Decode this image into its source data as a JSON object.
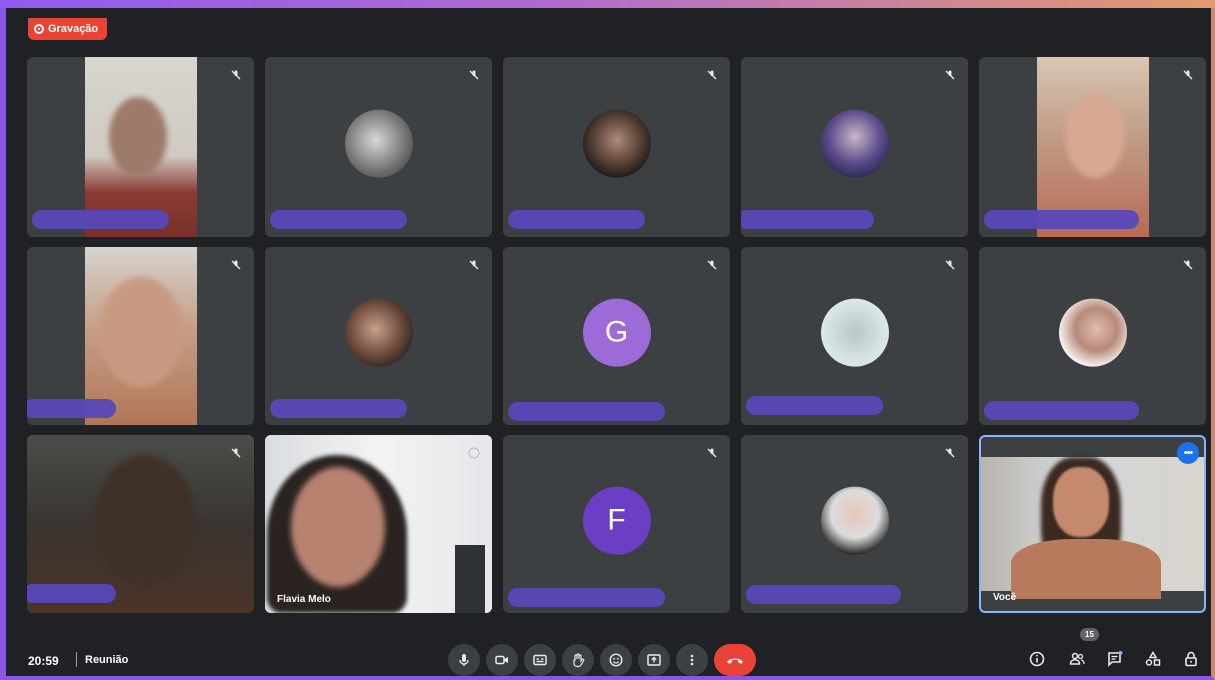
{
  "recording": {
    "label": "Gravação"
  },
  "tiles": [
    {
      "id": "t1",
      "letter": "",
      "name": ""
    },
    {
      "id": "t2",
      "letter": "",
      "name": ""
    },
    {
      "id": "t3",
      "letter": "",
      "name": ""
    },
    {
      "id": "t4",
      "letter": "",
      "name": ""
    },
    {
      "id": "t5",
      "letter": "",
      "name": ""
    },
    {
      "id": "t6",
      "letter": "",
      "name": ""
    },
    {
      "id": "t7",
      "letter": "",
      "name": ""
    },
    {
      "id": "t8",
      "letter": "G",
      "name": ""
    },
    {
      "id": "t9",
      "letter": "",
      "name": ""
    },
    {
      "id": "t10",
      "letter": "",
      "name": ""
    },
    {
      "id": "t11",
      "letter": "",
      "name": ""
    },
    {
      "id": "t12",
      "letter": "",
      "name": "Flavia Melo"
    },
    {
      "id": "t13",
      "letter": "F",
      "name": ""
    },
    {
      "id": "t14",
      "letter": "",
      "name": ""
    },
    {
      "id": "t15",
      "letter": "",
      "name": "Você",
      "more_icon": "more-horiz-icon",
      "more_label": "•••"
    }
  ],
  "colors": {
    "accent": "#1a73e8",
    "tile_bg": "#3c4043",
    "name_bar": "#5848b8",
    "avatar_g": "#9c6bd8",
    "avatar_f": "#6a3fc4",
    "hangup": "#ea4335"
  },
  "bottom_bar": {
    "time": "20:59",
    "meeting_title": "Reunião",
    "controls": [
      "microphone-icon",
      "camera-icon",
      "captions-icon",
      "raise-hand-icon",
      "emoji-icon",
      "present-icon",
      "more-vert-icon",
      "hangup-icon"
    ],
    "right_controls": [
      "info-icon",
      "people-icon",
      "chat-icon",
      "activities-icon",
      "host-controls-icon"
    ],
    "participant_count": "15"
  }
}
